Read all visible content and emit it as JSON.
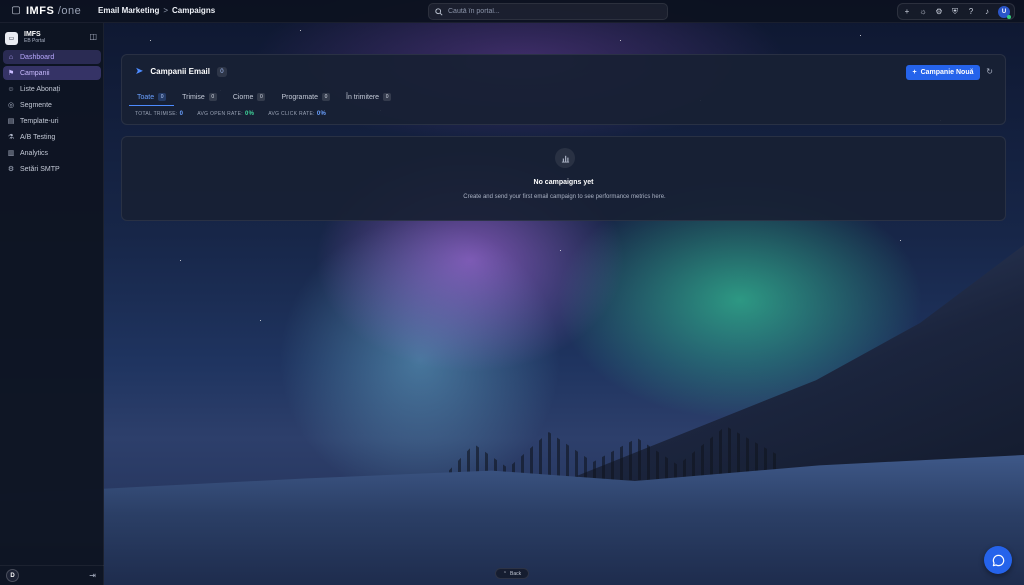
{
  "topbar": {
    "logo_main": "IMFS",
    "logo_sep": " /",
    "logo_suffix": "one",
    "breadcrumb": [
      "Email Marketing",
      "Campaigns"
    ],
    "breadcrumb_separator": ">",
    "search_placeholder": "Caută în portal...",
    "user_initial": "U",
    "icons": [
      "plus-icon",
      "sun-icon",
      "grid-icon",
      "shield-icon",
      "help-icon",
      "bell-icon"
    ]
  },
  "sidebar": {
    "brand_name": "IMFS",
    "brand_sub": "EB Portal",
    "brand_logo_text": "IMFS",
    "items": [
      {
        "label": "Dashboard",
        "icon": "dashboard-icon",
        "state": "active"
      },
      {
        "label": "Campanii",
        "icon": "campaign-icon",
        "state": "selected"
      },
      {
        "label": "Liste Abonați",
        "icon": "users-icon",
        "state": ""
      },
      {
        "label": "Segmente",
        "icon": "segments-icon",
        "state": ""
      },
      {
        "label": "Template-uri",
        "icon": "template-icon",
        "state": ""
      },
      {
        "label": "A/B Testing",
        "icon": "ab-test-icon",
        "state": ""
      },
      {
        "label": "Analytics",
        "icon": "analytics-icon",
        "state": ""
      },
      {
        "label": "Setări SMTP",
        "icon": "settings-icon",
        "state": ""
      }
    ],
    "user_initial": "D"
  },
  "campaigns": {
    "title": "Campanii Email",
    "count": "0",
    "new_button": "Campanie Nouă",
    "tabs": [
      {
        "label": "Toate",
        "count": "0"
      },
      {
        "label": "Trimise",
        "count": "0"
      },
      {
        "label": "Ciorne",
        "count": "0"
      },
      {
        "label": "Programate",
        "count": "0"
      },
      {
        "label": "În trimitere",
        "count": "0"
      }
    ],
    "stats": [
      {
        "label": "TOTAL TRIMISE:",
        "value": "0",
        "color": "blue"
      },
      {
        "label": "AVG OPEN RATE:",
        "value": "0%",
        "color": "green"
      },
      {
        "label": "AVG CLICK RATE:",
        "value": "0%",
        "color": "blue"
      }
    ]
  },
  "empty_state": {
    "title": "No campaigns yet",
    "description": "Create and send your first email campaign to see performance metrics here."
  },
  "footer": {
    "back_label": "Back"
  },
  "colors": {
    "accent": "#2563eb",
    "active_nav": "#b8a8ff",
    "success": "#3fd49a"
  }
}
